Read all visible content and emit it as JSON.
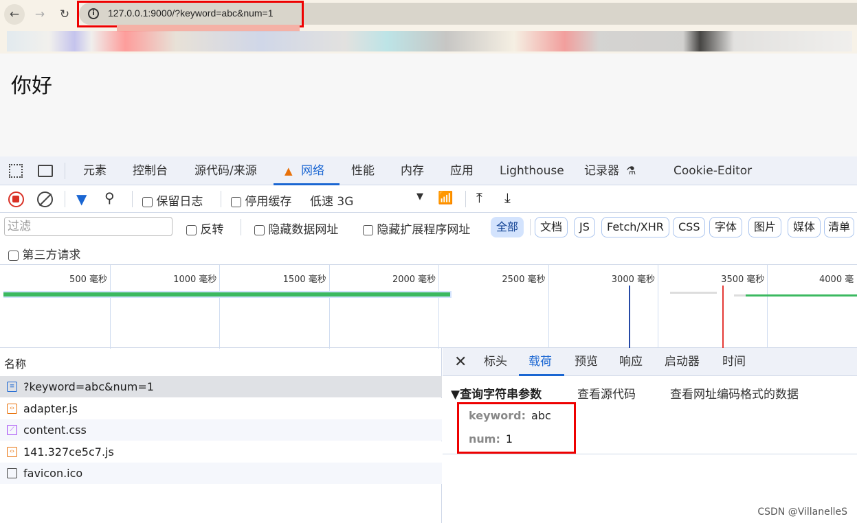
{
  "browser": {
    "url": "127.0.0.1:9000/?keyword=abc&num=1",
    "back": "←",
    "forward": "→",
    "reload": "↻"
  },
  "page": {
    "text": "你好"
  },
  "devtools": {
    "tabs": [
      "元素",
      "控制台",
      "源代码/来源",
      "网络",
      "性能",
      "内存",
      "应用",
      "Lighthouse",
      "记录器",
      "Cookie-Editor"
    ],
    "active_tab": "网络",
    "toolbar": {
      "preserve_log": "保留日志",
      "disable_cache": "停用缓存",
      "throttle": "低速 3G"
    },
    "filter": {
      "placeholder": "过滤",
      "invert": "反转",
      "hide_data_urls": "隐藏数据网址",
      "hide_ext_urls": "隐藏扩展程序网址",
      "types": [
        "全部",
        "文档",
        "JS",
        "Fetch/XHR",
        "CSS",
        "字体",
        "图片",
        "媒体",
        "清单"
      ],
      "third_party": "第三方请求"
    },
    "timeline": {
      "ticks": [
        "500 毫秒",
        "1000 毫秒",
        "1500 毫秒",
        "2000 毫秒",
        "2500 毫秒",
        "3000 毫秒",
        "3500 毫秒",
        "4000 毫"
      ]
    },
    "list": {
      "header": "名称",
      "rows": [
        {
          "name": "?keyword=abc&num=1",
          "type": "document",
          "color": "#1a66d2"
        },
        {
          "name": "adapter.js",
          "type": "script",
          "color": "#e8710a"
        },
        {
          "name": "content.css",
          "type": "stylesheet",
          "color": "#a142f4"
        },
        {
          "name": "141.327ce5c7.js",
          "type": "script",
          "color": "#e8710a"
        },
        {
          "name": "favicon.ico",
          "type": "other",
          "color": "#444"
        }
      ]
    },
    "detail": {
      "tabs": [
        "标头",
        "载荷",
        "预览",
        "响应",
        "启动器",
        "时间"
      ],
      "active": "载荷",
      "section": "▼查询字符串参数",
      "view_source": "查看源代码",
      "view_url_encoded": "查看网址编码格式的数据",
      "params": [
        {
          "key": "keyword:",
          "value": "abc"
        },
        {
          "key": "num:",
          "value": "1"
        }
      ]
    }
  },
  "watermark": "CSDN @VillanelleS"
}
